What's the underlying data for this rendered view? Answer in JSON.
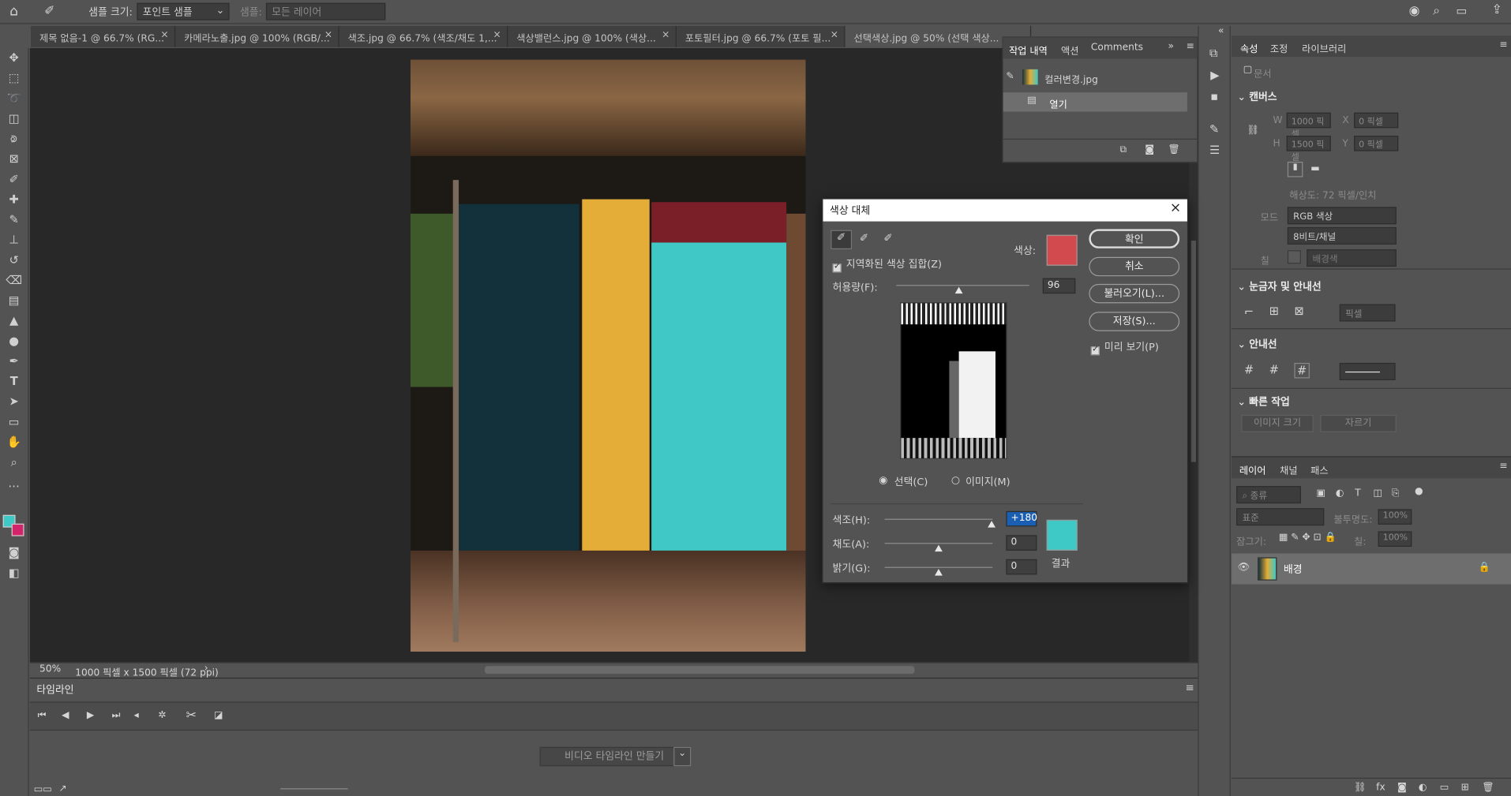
{
  "options_bar": {
    "sample_size_label": "샘플 크기:",
    "sample_size_value": "포인트 샘플",
    "sample_label": "샘플:",
    "sample_value": "모든 레이어"
  },
  "doc_tabs": [
    "제목 없음-1 @ 66.7% (RG...",
    "카메라노출.jpg @ 100% (RGB/...",
    "색조.jpg @ 66.7% (색조/채도 1,...",
    "색상밸런스.jpg @ 100% (색상...",
    "포토필터.jpg @ 66.7% (포토 필...",
    "선택색상.jpg @ 50% (선택 색상..."
  ],
  "history_panel": {
    "tabs": [
      "작업 내역",
      "액션",
      "Comments"
    ],
    "snapshot": "컬러변경.jpg",
    "item": "열기"
  },
  "dialog": {
    "title": "색상 대체",
    "localized_label": "지역화된 색상 집합(Z)",
    "color_label": "색상:",
    "fuzziness_label": "허용량(F):",
    "fuzziness_value": "96",
    "selection_label": "선택(C)",
    "image_label": "이미지(M)",
    "hue_label": "색조(H):",
    "hue_value": "+180",
    "sat_label": "채도(A):",
    "sat_value": "0",
    "light_label": "밝기(G):",
    "light_value": "0",
    "result_label": "결과",
    "ok": "확인",
    "cancel": "취소",
    "load": "불러오기(L)...",
    "save": "저장(S)...",
    "preview": "미리 보기(P)",
    "selected_color": "#d24a4e",
    "result_color": "#3ec9c7"
  },
  "properties": {
    "tabs": [
      "속성",
      "조정",
      "라이브러리"
    ],
    "doc_label": "문서",
    "canvas_title": "캔버스",
    "w_label": "W",
    "w_value": "1000 픽셀",
    "h_label": "H",
    "h_value": "1500 픽셀",
    "x_label": "X",
    "x_value": "0 픽셀",
    "y_label": "Y",
    "y_value": "0 픽셀",
    "resolution": "해상도: 72 픽셀/인치",
    "mode_label": "모드",
    "mode_value": "RGB 색상",
    "bits_value": "8비트/채널",
    "fill_label": "칠",
    "fill_value": "배경색",
    "rulers_title": "눈금자 및 안내선",
    "rulers_unit": "픽셀",
    "guides_title": "안내선",
    "quick_title": "빠른 작업",
    "image_size": "이미지 크기",
    "crop": "자르기"
  },
  "layers": {
    "tabs": [
      "레이어",
      "채널",
      "패스"
    ],
    "filter": "종류",
    "blend": "표준",
    "opacity_label": "불투명도:",
    "opacity_value": "100%",
    "lock_label": "잠그기:",
    "fill_label": "칠:",
    "fill_value": "100%",
    "layer_name": "배경"
  },
  "status": {
    "zoom": "50%",
    "doc_info": "1000 픽셀 x 1500 픽셀 (72 ppi)"
  },
  "timeline": {
    "title": "타임라인",
    "create_button": "비디오 타임라인 만들기"
  }
}
